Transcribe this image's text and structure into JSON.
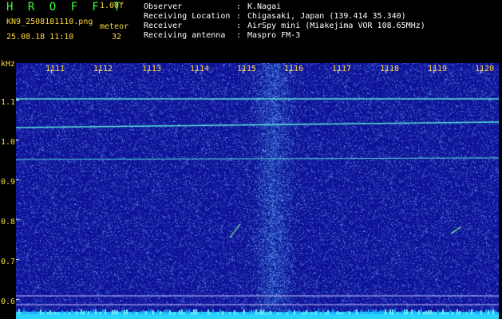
{
  "app": {
    "title": "H R O F F T",
    "version": "1.00f"
  },
  "file": {
    "name": "KN9_2508181110.png",
    "datetime": "25.08.18 11:10"
  },
  "meteor": {
    "label": "meteor",
    "count": "32"
  },
  "info": [
    {
      "label": "Observer",
      "sep": ":",
      "value": "K.Nagai"
    },
    {
      "label": "Receiving Location",
      "sep": ":",
      "value": "Chigasaki, Japan (139.414 35.340)"
    },
    {
      "label": "Receiver",
      "sep": ":",
      "value": "AirSpy mini (Miakejima VOR 108.65MHz)"
    },
    {
      "label": "Receiving antenna",
      "sep": ":",
      "value": "Maspro FM-3"
    }
  ],
  "axis": {
    "y_unit": "kHz",
    "y_ticks": [
      "1.1",
      "1.0",
      "0.9",
      "0.8",
      "0.7",
      "0.6"
    ],
    "time_ticks": [
      "1111",
      "1112",
      "1113",
      "1114",
      "1115",
      "1116",
      "1117",
      "1118",
      "1119",
      "1120"
    ]
  },
  "colors": {
    "label_yellow": "#ffd83a",
    "title_green": "#3dff3d",
    "background_blue": "#1414b4",
    "carrier_cyan": "#59e6d6"
  }
}
